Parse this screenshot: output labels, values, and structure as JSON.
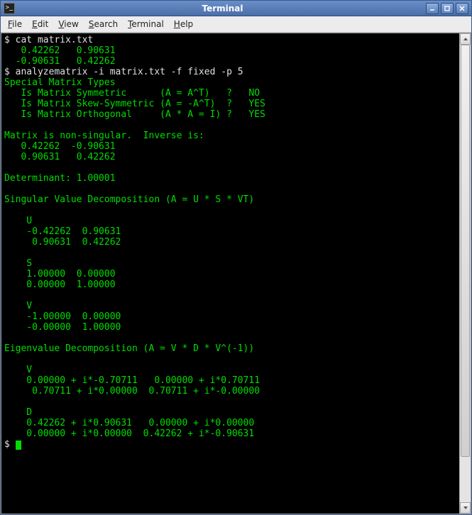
{
  "window": {
    "title": "Terminal"
  },
  "menu": {
    "file": "File",
    "edit": "Edit",
    "view": "View",
    "search": "Search",
    "terminal": "Terminal",
    "help": "Help"
  },
  "term": {
    "prompt1": "$ ",
    "cmd1": "cat matrix.txt",
    "out1a": "   0.42262   0.90631",
    "out1b": "  -0.90631   0.42262",
    "prompt2": "$ ",
    "cmd2": "analyzematrix -i matrix.txt -f fixed -p 5",
    "hdr_special": "Special Matrix Types",
    "sym": "   Is Matrix Symmetric      (A = A^T)   ?   NO",
    "skew": "   Is Matrix Skew-Symmetric (A = -A^T)  ?   YES",
    "orth": "   Is Matrix Orthogonal     (A * A = I) ?   YES",
    "blank": "",
    "inv_hdr": "Matrix is non-singular.  Inverse is:",
    "inv_a": "   0.42262  -0.90631",
    "inv_b": "   0.90631   0.42262",
    "det": "Determinant: 1.00001",
    "svd_hdr": "Singular Value Decomposition (A = U * S * VT)",
    "svd_u": "    U",
    "svd_u1": "    -0.42262  0.90631",
    "svd_u2": "     0.90631  0.42262",
    "svd_s": "    S",
    "svd_s1": "    1.00000  0.00000",
    "svd_s2": "    0.00000  1.00000",
    "svd_v": "    V",
    "svd_v1": "    -1.00000  0.00000",
    "svd_v2": "    -0.00000  1.00000",
    "eig_hdr": "Eigenvalue Decomposition (A = V * D * V^(-1))",
    "eig_v": "    V",
    "eig_v1": "    0.00000 + i*-0.70711   0.00000 + i*0.70711",
    "eig_v2": "     0.70711 + i*0.00000  0.70711 + i*-0.00000",
    "eig_d": "    D",
    "eig_d1": "    0.42262 + i*0.90631   0.00000 + i*0.00000",
    "eig_d2": "    0.00000 + i*0.00000  0.42262 + i*-0.90631",
    "prompt3": "$ "
  }
}
